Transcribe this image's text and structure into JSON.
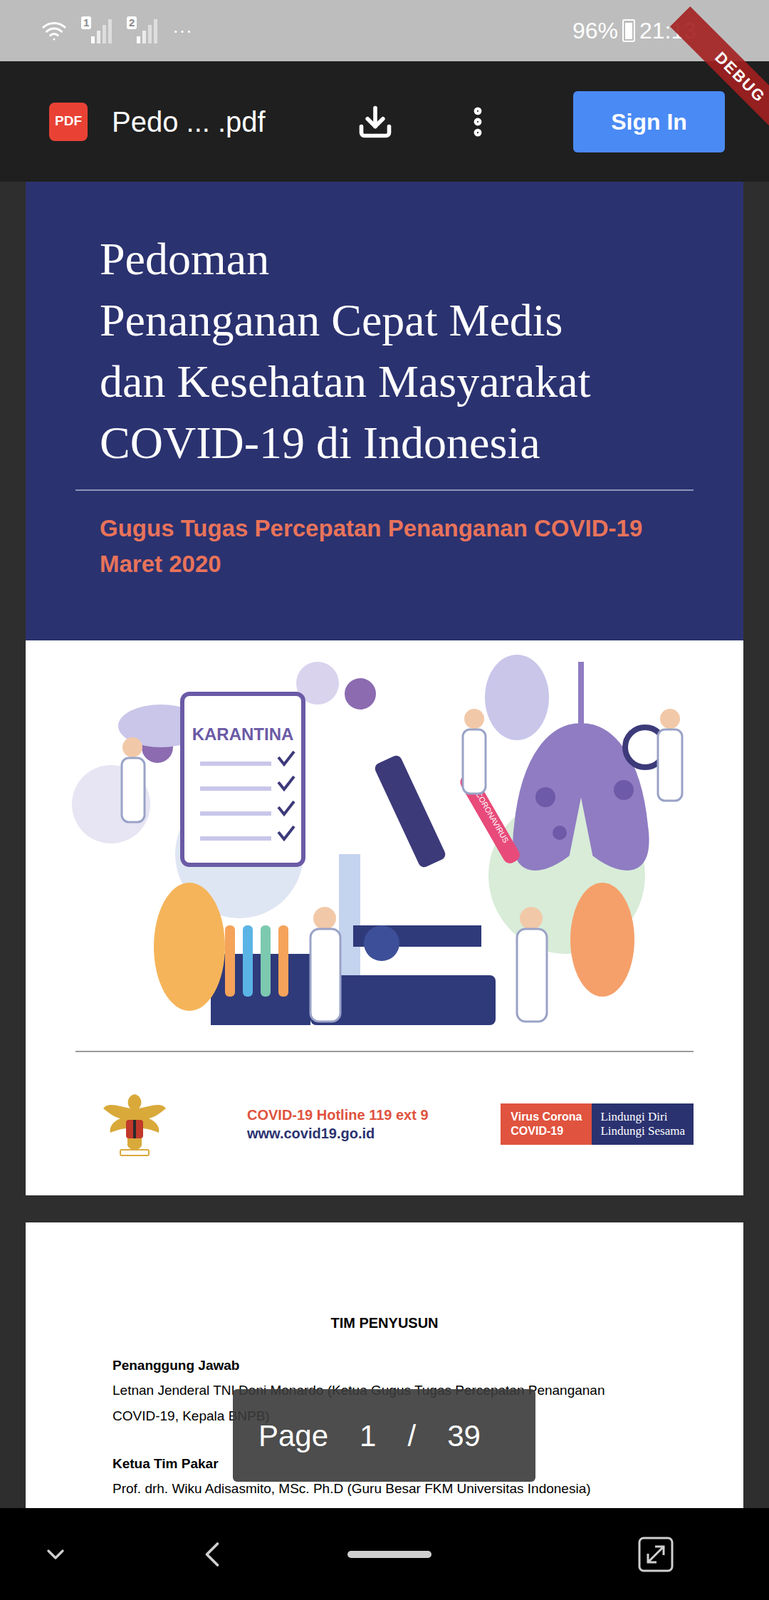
{
  "status_bar": {
    "sim1": "1",
    "sim2": "2",
    "more": "···",
    "battery": "96%",
    "battery_level": 0.96,
    "time": "21:13",
    "ribbon": "DEBUG"
  },
  "app_bar": {
    "file_badge": "PDF",
    "title": "Pedo ... .pdf",
    "sign_in": "Sign In"
  },
  "cover": {
    "title_lines": [
      "Pedoman",
      "Penanganan Cepat Medis",
      "dan Kesehatan Masyarakat",
      "COVID-19 di Indonesia"
    ],
    "subtitle_lines": [
      "Gugus Tugas Percepatan Penanganan COVID-19",
      "Maret 2020"
    ],
    "illustration": {
      "clipboard": "KARANTINA",
      "tube_label": "CORONAVIRUS"
    },
    "hotline": "COVID-19 Hotline 119 ext 9",
    "website": "www.covid19.go.id",
    "badge_left": [
      "Virus Corona",
      "COVID-19"
    ],
    "badge_right": [
      "Lindungi Diri",
      "Lindungi Sesama"
    ]
  },
  "page2": {
    "heading": "TIM PENYUSUN",
    "sections": [
      {
        "label": "Penanggung Jawab",
        "lines": [
          "Letnan Jenderal TNI Doni Monardo (Ketua Gugus Tugas Percepatan Penanganan",
          "COVID-19, Kepala BNPB)"
        ]
      },
      {
        "label": "Ketua Tim Pakar",
        "lines": [
          "Prof. drh. Wiku Adisasmito, MSc. Ph.D (Guru Besar FKM Universitas Indonesia)"
        ]
      }
    ]
  },
  "page_indicator": {
    "label": "Page",
    "current": "1",
    "separator": "/",
    "total": "39"
  }
}
